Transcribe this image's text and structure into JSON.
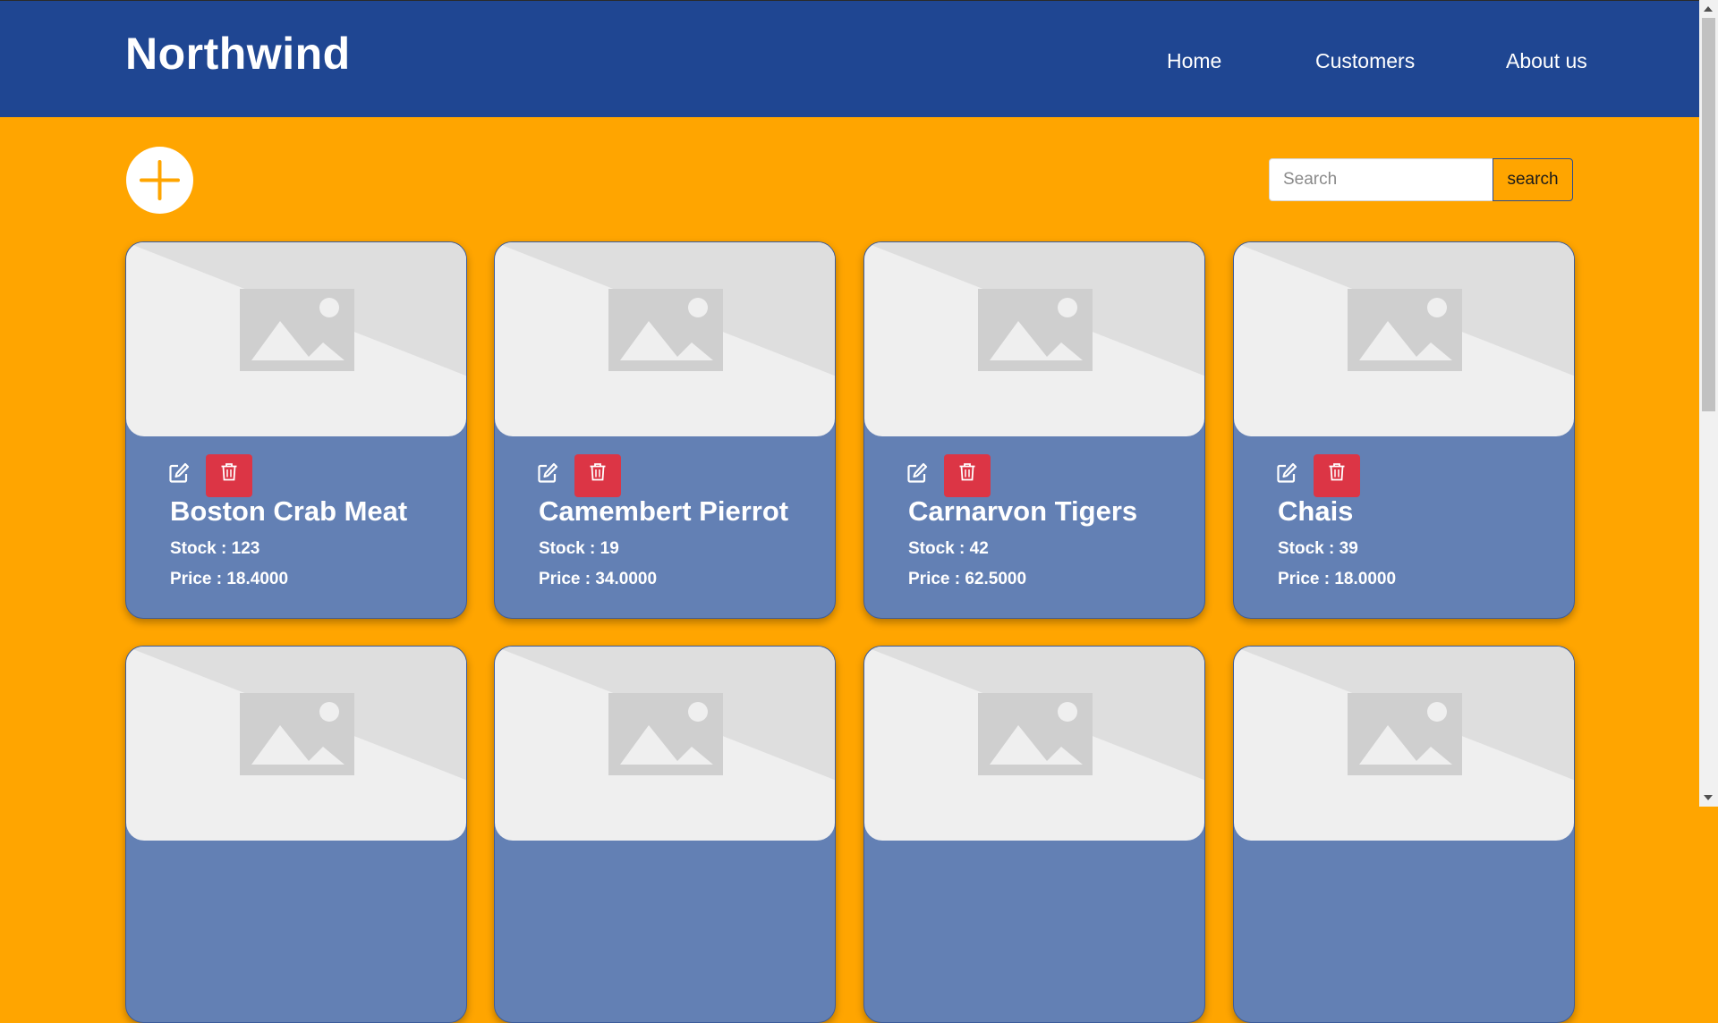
{
  "header": {
    "brand": "Northwind",
    "nav": [
      {
        "label": "Home"
      },
      {
        "label": "Customers"
      },
      {
        "label": "About us"
      }
    ]
  },
  "toolbar": {
    "add_icon": "plus-icon",
    "search": {
      "placeholder": "Search",
      "value": "",
      "button_label": "search"
    }
  },
  "colors": {
    "navbar": "#1F4692",
    "page_background": "#FFA500",
    "card_background": "#6380B4",
    "delete_button": "#DC3545"
  },
  "products": [
    {
      "name": "Boston Crab Meat",
      "stock": "Stock : 123",
      "price": "Price : 18.4000"
    },
    {
      "name": "Camembert Pierrot",
      "stock": "Stock : 19",
      "price": "Price : 34.0000"
    },
    {
      "name": "Carnarvon Tigers",
      "stock": "Stock : 42",
      "price": "Price : 62.5000"
    },
    {
      "name": "Chais",
      "stock": "Stock : 39",
      "price": "Price : 18.0000"
    },
    {
      "name": "",
      "stock": "",
      "price": ""
    },
    {
      "name": "",
      "stock": "",
      "price": ""
    },
    {
      "name": "",
      "stock": "",
      "price": ""
    },
    {
      "name": "",
      "stock": "",
      "price": ""
    }
  ],
  "card_icons": {
    "image": "image-placeholder-icon",
    "edit": "edit-icon",
    "delete": "trash-icon"
  }
}
